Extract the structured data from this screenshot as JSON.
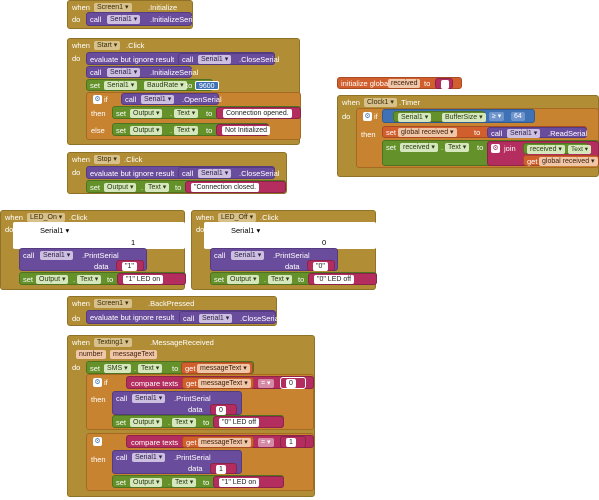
{
  "kw": {
    "when": "when",
    "do": "do",
    "call": "call",
    "set": "set",
    "to": "to",
    "if": "if",
    "then": "then",
    "else": "else",
    "get": "get",
    "join": "join",
    "evaluate": "evaluate but ignore result",
    "compare": "compare texts",
    "initialize": "initialize global",
    "data": "data",
    "number": "number"
  },
  "components": {
    "screen1": "Screen1",
    "serial1": "Serial1",
    "start": "Start",
    "stop": "Stop",
    "led_on": "LED_On",
    "led_off": "LED_Off",
    "clock1": "Clock1",
    "output": "Output",
    "texting1": "Texting1",
    "sms": "SMS"
  },
  "events": {
    "initialize": ".Initialize",
    "click": ".Click",
    "timer": ".Timer",
    "back": ".BackPressed",
    "msg": ".MessageReceived"
  },
  "methods": {
    "initserial": ".InitializeSerial",
    "closeserial": ".CloseSerial",
    "openserial": ".OpenSerial",
    "printserial": ".PrintSerial",
    "readserial": ".ReadSerial"
  },
  "props": {
    "baudrate": "BaudRate",
    "text": "Text",
    "buffersize": "BufferSize"
  },
  "values": {
    "baud": "9600",
    "conn_opened": "Connection opened.",
    "not_init": "Not Initialized",
    "conn_closed": "\"Connection closed.",
    "one": "1",
    "zero": "0",
    "one_q": "\"1\"",
    "zero_q": "\"0\"",
    "led_on_txt": "\"1\" LED on",
    "led_off_txt": "\"0\" LED off",
    "buf": "64",
    "gte": "≥",
    "eq": "=",
    "empty": ""
  },
  "globals": {
    "received": "received",
    "global_received": "global received"
  },
  "params": {
    "number": "number",
    "messageText": "messageText"
  }
}
